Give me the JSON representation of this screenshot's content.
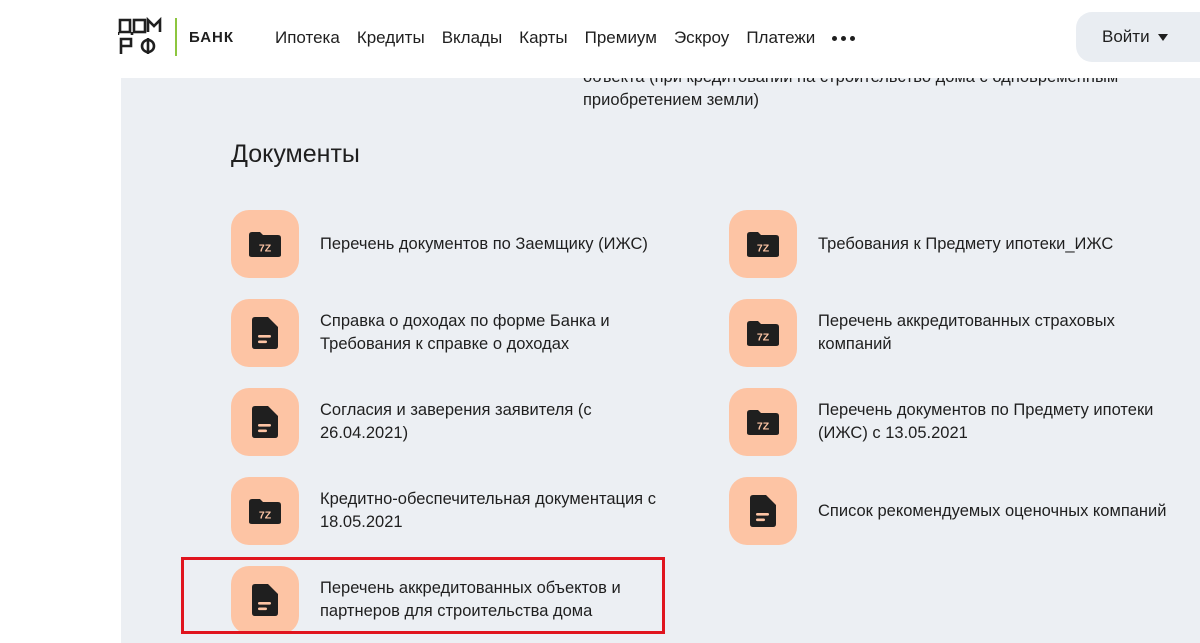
{
  "header": {
    "logo_text": "ДОМ РФ",
    "bank_label": "БАНК",
    "nav": [
      "Ипотека",
      "Кредиты",
      "Вклады",
      "Карты",
      "Премиум",
      "Эскроу",
      "Платежи"
    ],
    "more_icon": "more-dots-icon",
    "login_label": "Войти"
  },
  "cut_text": {
    "line1": "объекта (при кредитовании на строительство дома с одновременным",
    "line2": "приобретением земли)"
  },
  "section": {
    "title": "Документы"
  },
  "documents": [
    {
      "icon": "archive-7z-icon",
      "icon_text": "7Z",
      "lines": [
        "Перечень документов по Заемщику (ИЖС)"
      ]
    },
    {
      "icon": "archive-7z-icon",
      "icon_text": "7Z",
      "lines": [
        "Требования к Предмету ипотеки_ИЖС"
      ]
    },
    {
      "icon": "document-icon",
      "icon_text": "",
      "lines": [
        "Справка о доходах по форме Банка и",
        "Требования к справке о доходах"
      ]
    },
    {
      "icon": "archive-7z-icon",
      "icon_text": "7Z",
      "lines": [
        "Перечень аккредитованных страховых",
        "компаний"
      ]
    },
    {
      "icon": "document-icon",
      "icon_text": "",
      "lines": [
        "Согласия и заверения заявителя (с",
        "26.04.2021)"
      ]
    },
    {
      "icon": "archive-7z-icon",
      "icon_text": "7Z",
      "lines": [
        "Перечень документов по Предмету ипотеки",
        "(ИЖС) с 13.05.2021"
      ]
    },
    {
      "icon": "archive-7z-icon",
      "icon_text": "7Z",
      "lines": [
        "Кредитно-обеспечительная документация с",
        "18.05.2021"
      ]
    },
    {
      "icon": "document-icon",
      "icon_text": "",
      "lines": [
        "Список рекомендуемых оценочных компаний"
      ]
    },
    {
      "icon": "document-icon",
      "icon_text": "",
      "lines": [
        "Перечень аккредитованных объектов и",
        "партнеров для строительства дома"
      ]
    }
  ],
  "colors": {
    "accent_green": "#8dc63f",
    "icon_bg": "#fdc4a4",
    "content_bg": "#eceff3",
    "highlight": "#e0141e"
  }
}
